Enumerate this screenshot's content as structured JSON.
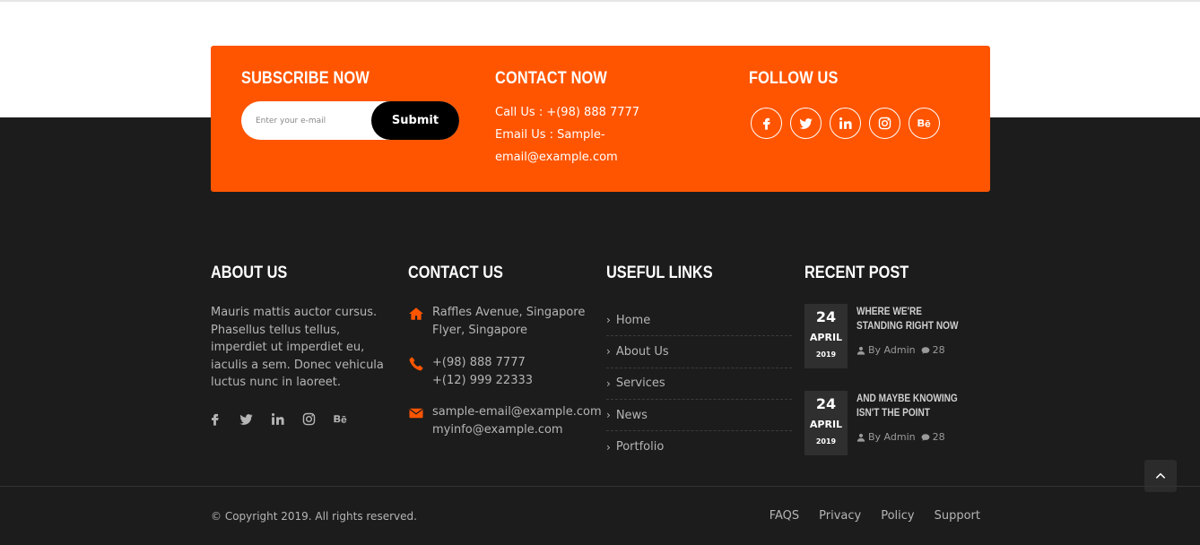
{
  "subscribe": {
    "title": "SUBSCRIBE NOW",
    "placeholder": "Enter your e-mail",
    "button": "Submit"
  },
  "contact_now": {
    "title": "CONTACT NOW",
    "call": "Call Us : +(98) 888 7777",
    "email": "Email Us : Sample-email@example.com"
  },
  "follow": {
    "title": "FOLLOW US",
    "icons": [
      "facebook-icon",
      "twitter-icon",
      "linkedin-icon",
      "instagram-icon",
      "behance-icon"
    ]
  },
  "about": {
    "title": "ABOUT US",
    "text": "Mauris mattis auctor cursus. Phasellus tellus tellus, imperdiet ut imperdiet eu, iaculis a sem. Donec vehicula luctus nunc in laoreet."
  },
  "contact": {
    "title": "CONTACT US",
    "address": [
      "Raffles Avenue, Singapore",
      "Flyer, Singapore"
    ],
    "phones": [
      "+(98) 888 7777",
      "+(12) 999 22333"
    ],
    "emails": [
      "sample-email@example.com",
      "myinfo@example.com"
    ]
  },
  "useful_links": {
    "title": "USEFUL LINKS",
    "items": [
      "Home",
      "About Us",
      "Services",
      "News",
      "Portfolio"
    ]
  },
  "recent": {
    "title": "RECENT POST",
    "posts": [
      {
        "day": "24",
        "month": "APRIL",
        "year": "2019",
        "title": "WHERE WE'RE STANDING RIGHT NOW",
        "author": "By Admin",
        "comments": "28"
      },
      {
        "day": "24",
        "month": "APRIL",
        "year": "2019",
        "title": "AND MAYBE KNOWING ISN'T THE POINT",
        "author": "By Admin",
        "comments": "28"
      }
    ]
  },
  "footer": {
    "copyright": "© Copyright 2019. All rights reserved.",
    "links": [
      "FAQS",
      "Privacy",
      "Policy",
      "Support"
    ]
  },
  "colors": {
    "accent": "#ff5500",
    "dark": "#1c1c1c"
  }
}
